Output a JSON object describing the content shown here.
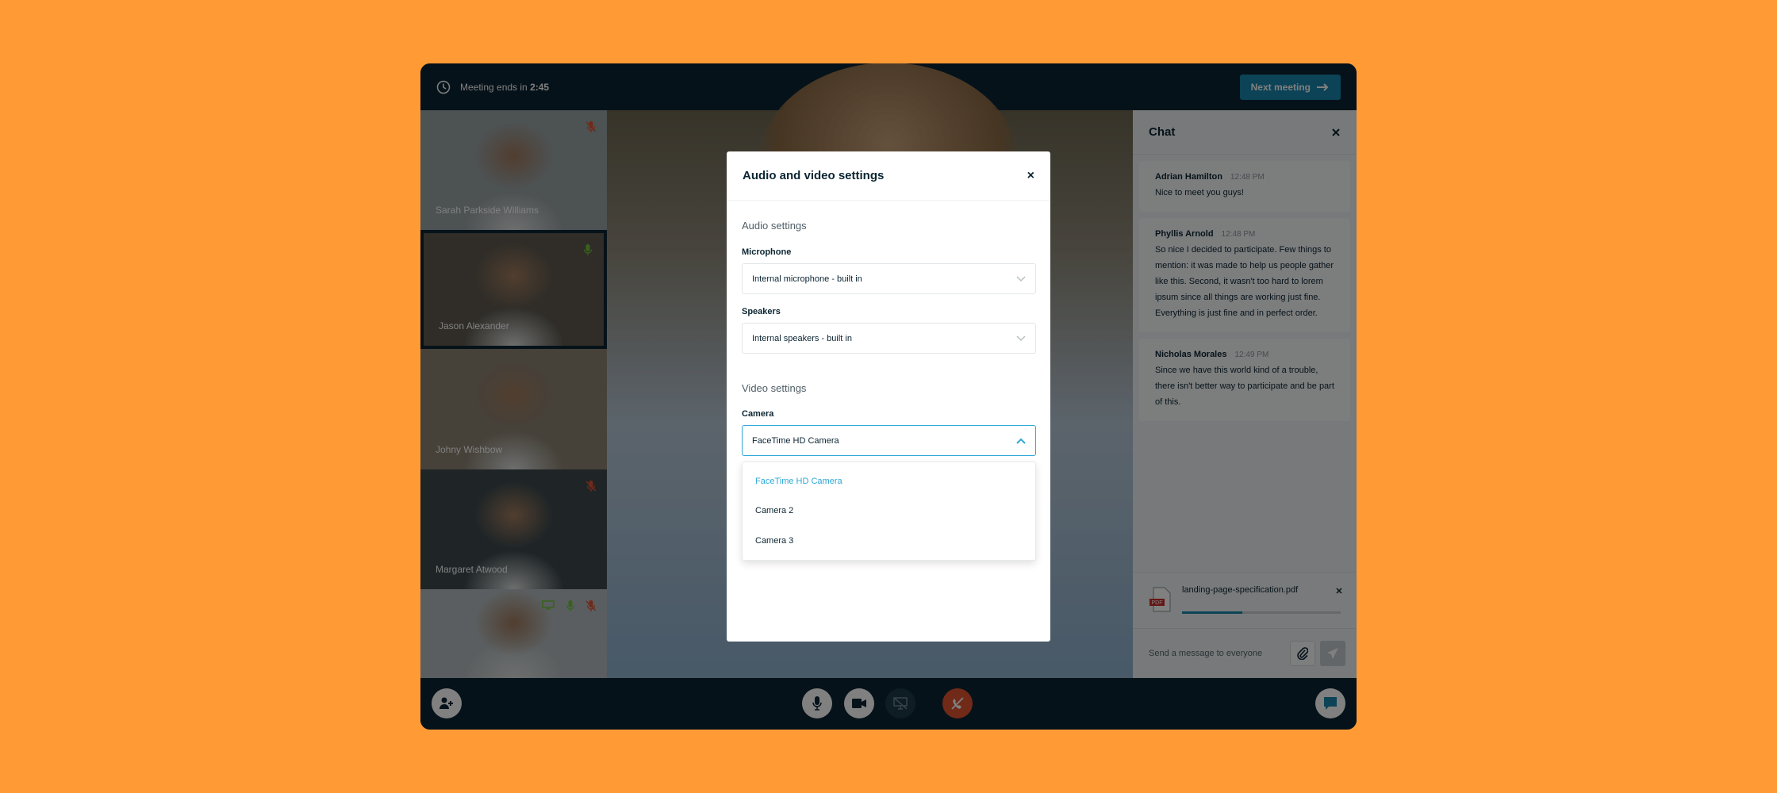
{
  "topbar": {
    "timer_prefix": "Meeting ends in",
    "timer_value": "2:45",
    "next_meeting_label": "Next meeting",
    "icons": [
      "clock-icon",
      "arrow-right-icon"
    ]
  },
  "participants": [
    {
      "name": "Sarah Parkside Williams",
      "mic": "muted",
      "tone": "#9aa3a6"
    },
    {
      "name": "Jason Alexander",
      "mic": "on",
      "active": true,
      "tone": "#5f5a50"
    },
    {
      "name": "Johny Wishbow",
      "mic": "none",
      "tone": "#8c8272"
    },
    {
      "name": "Margaret Atwood",
      "mic": "muted",
      "tone": "#3e4a4e"
    },
    {
      "name": "",
      "mic": "muted",
      "screen": "on",
      "mic2": "on",
      "tone": "#b4bcbf"
    }
  ],
  "chat": {
    "title": "Chat",
    "messages": [
      {
        "author": "Adrian Hamilton",
        "time": "12:48 PM",
        "text": "Nice to meet you guys!"
      },
      {
        "author": "Phyllis Arnold",
        "time": "12:48 PM",
        "text": "So nice I decided to participate. Few things to mention: it was made to help us people gather like this. Second, it wasn't too hard to lorem ipsum since all things are working just fine. Everything is just fine and in perfect order."
      },
      {
        "author": "Nicholas Morales",
        "time": "12:49 PM",
        "text": "Since we have this world kind of a trouble, there isn't better way to participate and be part of this."
      }
    ],
    "attachment": {
      "file_name": "landing-page-specification.pdf",
      "badge": "PDF",
      "upload_progress_percent": 38
    },
    "input_placeholder": "Send a message to everyone"
  },
  "modal": {
    "title": "Audio and video settings",
    "close_label": "×",
    "audio_section": "Audio settings",
    "microphone_label": "Microphone",
    "microphone_value": "Internal microphone - built in",
    "speakers_label": "Speakers",
    "speakers_value": "Internal speakers - built in",
    "video_section": "Video settings",
    "camera_label": "Camera",
    "camera_value": "FaceTime HD Camera",
    "camera_options": [
      "FaceTime HD Camera",
      "Camera 2",
      "Camera 3"
    ]
  },
  "colors": {
    "accent": "#2ea8d6",
    "brand_dark": "#0b2532",
    "end_call": "#e2522f",
    "mic_on": "#6fc23a",
    "mic_muted": "#e2522f",
    "background": "#ff9a35"
  }
}
